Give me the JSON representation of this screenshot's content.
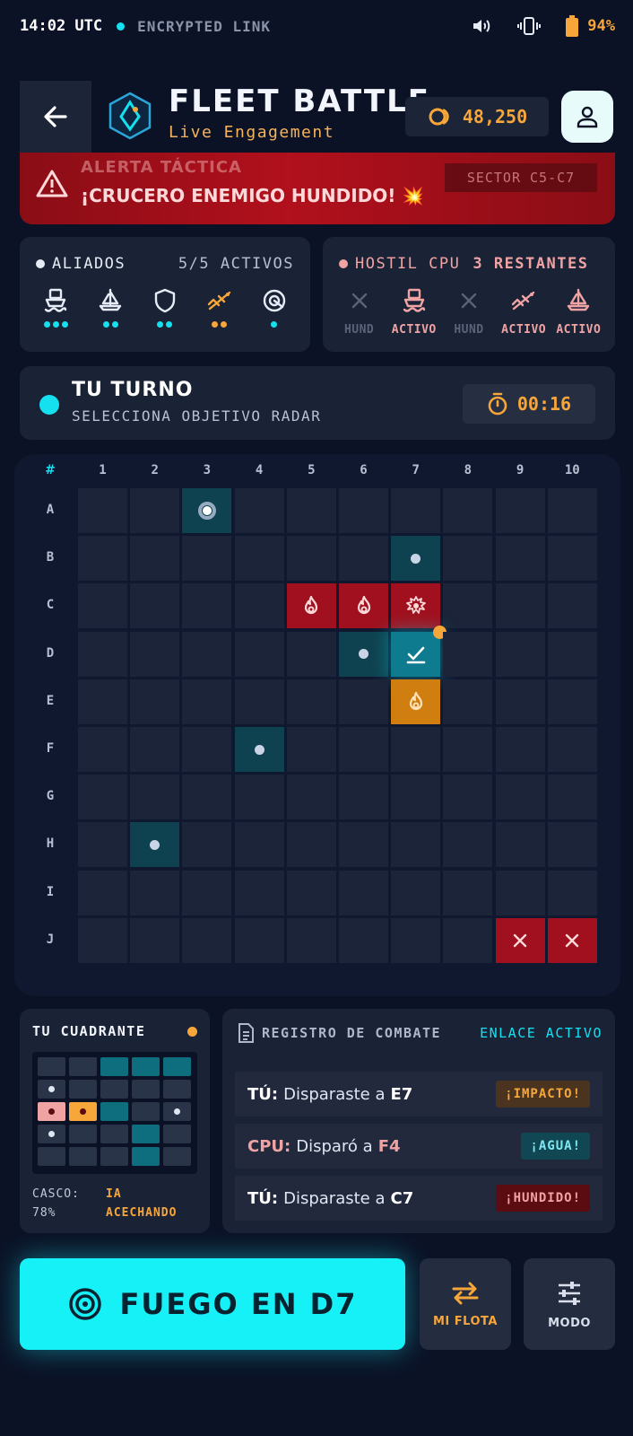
{
  "status_bar": {
    "time": "14:02 UTC",
    "link": "ENCRYPTED LINK",
    "battery": "94%"
  },
  "header": {
    "title": "FLEET BATTLE",
    "subtitle": "Live Engagement",
    "coins": "48,250"
  },
  "alert": {
    "title": "ALERTA TÁCTICA",
    "message": "¡CRUCERO ENEMIGO HUNDIDO! 💥",
    "sector": "SECTOR C5-C7"
  },
  "allies": {
    "label": "ALIADOS",
    "count": "5/5 ACTIVOS",
    "ships": [
      {
        "icon": "ship-icon",
        "pips": 3
      },
      {
        "icon": "sailboat-icon",
        "pips": 2
      },
      {
        "icon": "shield-icon",
        "pips": 2
      },
      {
        "icon": "submarine-icon",
        "pips": 2,
        "damaged": true
      },
      {
        "icon": "radar-icon",
        "pips": 1
      }
    ]
  },
  "hostile": {
    "label": "HOSTIL CPU",
    "count": "3 RESTANTES",
    "ships": [
      {
        "icon": "close-icon",
        "status": "HUND"
      },
      {
        "icon": "ship-icon",
        "status": "ACTIVO"
      },
      {
        "icon": "close-icon",
        "status": "HUND"
      },
      {
        "icon": "submarine-icon",
        "status": "ACTIVO"
      },
      {
        "icon": "sailboat-icon",
        "status": "ACTIVO"
      }
    ]
  },
  "turn": {
    "title": "TU TURNO",
    "subtitle": "SELECCIONA OBJETIVO RADAR",
    "timer": "00:16"
  },
  "grid": {
    "corner": "#",
    "columns": [
      "1",
      "2",
      "3",
      "4",
      "5",
      "6",
      "7",
      "8",
      "9",
      "10"
    ],
    "rows": [
      "A",
      "B",
      "C",
      "D",
      "E",
      "F",
      "G",
      "H",
      "I",
      "J"
    ],
    "cells": [
      {
        "row": 0,
        "col": 2,
        "state": "radar"
      },
      {
        "row": 1,
        "col": 6,
        "state": "miss"
      },
      {
        "row": 2,
        "col": 4,
        "state": "hit"
      },
      {
        "row": 2,
        "col": 5,
        "state": "hit"
      },
      {
        "row": 2,
        "col": 6,
        "state": "sunk"
      },
      {
        "row": 3,
        "col": 5,
        "state": "miss"
      },
      {
        "row": 3,
        "col": 6,
        "state": "target"
      },
      {
        "row": 4,
        "col": 6,
        "state": "warn"
      },
      {
        "row": 5,
        "col": 3,
        "state": "miss"
      },
      {
        "row": 7,
        "col": 1,
        "state": "miss"
      },
      {
        "row": 9,
        "col": 8,
        "state": "lost"
      },
      {
        "row": 9,
        "col": 9,
        "state": "lost"
      }
    ]
  },
  "quadrant": {
    "title": "TU CUADRANTE",
    "hull_label": "CASCO:",
    "hull_value": "78%",
    "ai_line1": "IA",
    "ai_line2": "ACECHANDO",
    "cells": [
      [
        "",
        "",
        "c",
        "c",
        "c"
      ],
      [
        "d",
        "",
        "",
        "",
        ""
      ],
      [
        "p",
        "o",
        "c",
        "",
        "d"
      ],
      [
        "d",
        "",
        "",
        "c",
        ""
      ],
      [
        "",
        "",
        "",
        "c",
        ""
      ]
    ]
  },
  "log": {
    "title": "REGISTRO DE COMBATE",
    "live": "ENLACE ACTIVO",
    "entries": [
      {
        "who": "TÚ:",
        "text": "Disparaste a",
        "cell": "E7",
        "badge": "¡IMPACTO!",
        "kind": "impact"
      },
      {
        "who": "CPU:",
        "text": "Disparó a",
        "cell": "F4",
        "badge": "¡AGUA!",
        "kind": "water"
      },
      {
        "who": "TÚ:",
        "text": "Disparaste a",
        "cell": "C7",
        "badge": "¡HUNDIDO!",
        "kind": "sunk"
      }
    ]
  },
  "actions": {
    "fire": "FUEGO EN D7",
    "fleet": "MI FLOTA",
    "mode": "MODO"
  },
  "colors": {
    "accent": "#15e0f0",
    "warning": "#f7a63a",
    "danger": "#a1101e",
    "background": "#0b1226"
  }
}
